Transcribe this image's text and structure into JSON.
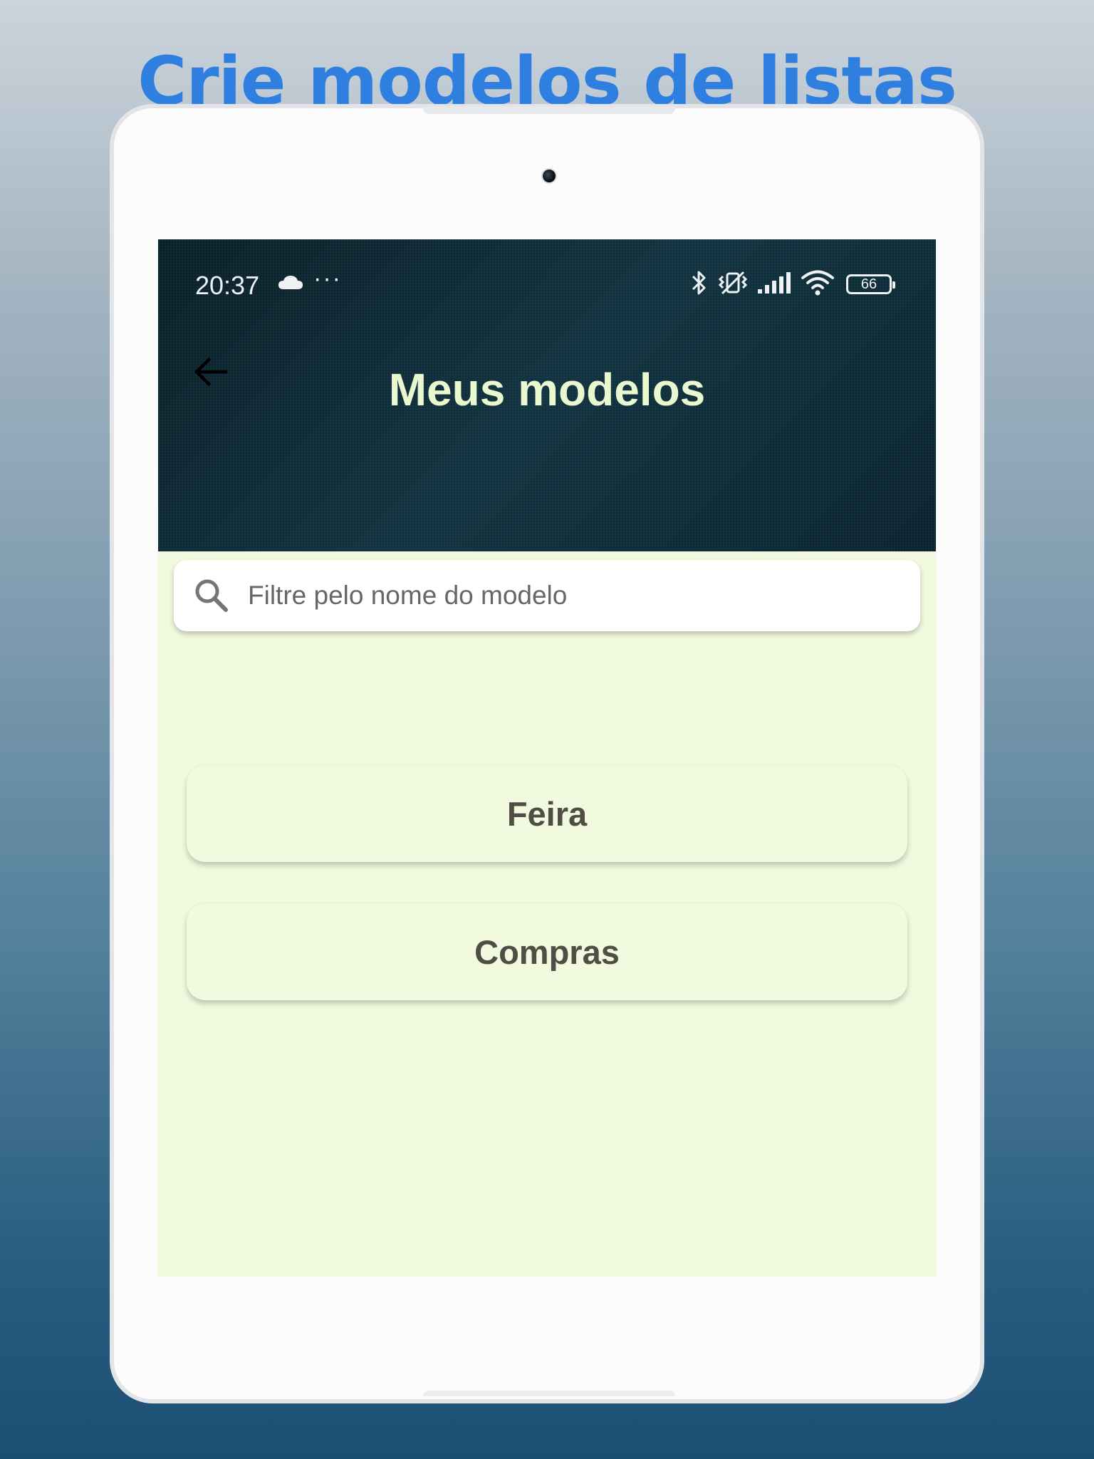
{
  "promo": {
    "title": "Crie modelos de listas"
  },
  "status_bar": {
    "time": "20:37",
    "dots": "···",
    "battery_level": "66",
    "icons": [
      "cloud-icon",
      "bluetooth-icon",
      "vibrate-icon",
      "signal-icon",
      "wifi-icon",
      "battery-icon"
    ]
  },
  "header": {
    "title": "Meus modelos",
    "back_icon": "arrow-left-icon"
  },
  "search": {
    "placeholder": "Filtre pelo nome do modelo",
    "value": ""
  },
  "templates": [
    {
      "label": "Feira"
    },
    {
      "label": "Compras"
    }
  ],
  "colors": {
    "promo_title": "#2f7fe0",
    "header_bg": "#0d2730",
    "header_title": "#eaf8cf",
    "content_bg": "#f1f9de",
    "card_text": "#4f4d44"
  }
}
